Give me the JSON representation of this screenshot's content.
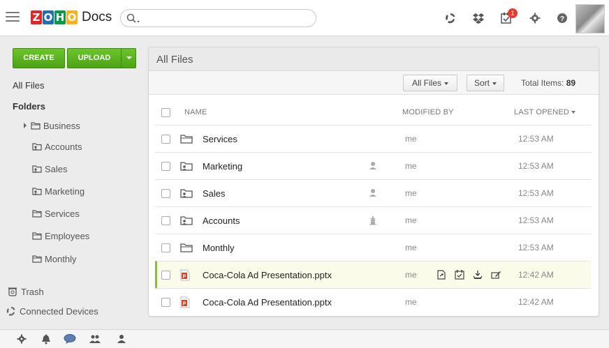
{
  "header": {
    "logo_letters": [
      "Z",
      "O",
      "H",
      "O"
    ],
    "logo_colors": [
      "#e42527",
      "#226db4",
      "#089949",
      "#f9b21d"
    ],
    "app_name": "Docs",
    "search_placeholder": "",
    "notification_count": "1",
    "icons": [
      "menu-icon",
      "search-icon",
      "sync-icon",
      "dropbox-icon",
      "tasks-icon",
      "gear-icon",
      "help-icon",
      "avatar"
    ]
  },
  "sidebar": {
    "create_label": "CREATE",
    "upload_label": "UPLOAD",
    "all_files": "All Files",
    "folders_heading": "Folders",
    "folders": [
      {
        "label": "Business",
        "icon": "folder-icon",
        "expandable": true
      },
      {
        "label": "Accounts",
        "icon": "shared-folder-icon"
      },
      {
        "label": "Sales",
        "icon": "shared-folder-icon"
      },
      {
        "label": "Marketing",
        "icon": "shared-folder-icon"
      },
      {
        "label": "Services",
        "icon": "folder-icon"
      },
      {
        "label": "Employees",
        "icon": "folder-icon"
      },
      {
        "label": "Monthly",
        "icon": "folder-icon"
      }
    ],
    "trash": "Trash",
    "connected_devices": "Connected Devices"
  },
  "main": {
    "title": "All Files",
    "filter_label": "All Files",
    "sort_label": "Sort",
    "total_label": "Total Items:",
    "total_count": "89",
    "columns": {
      "name": "NAME",
      "modified_by": "MODIFIED BY",
      "last_opened": "LAST OPENED"
    },
    "rows": [
      {
        "name": "Services",
        "icon": "folder-icon",
        "share": "",
        "modified_by": "me",
        "time": "12:53 AM"
      },
      {
        "name": "Marketing",
        "icon": "shared-folder-icon",
        "share": "user-icon",
        "modified_by": "me",
        "time": "12:53 AM"
      },
      {
        "name": "Sales",
        "icon": "shared-folder-icon",
        "share": "user-icon",
        "modified_by": "me",
        "time": "12:53 AM"
      },
      {
        "name": "Accounts",
        "icon": "shared-folder-icon",
        "share": "building-icon",
        "modified_by": "me",
        "time": "12:53 AM"
      },
      {
        "name": "Monthly",
        "icon": "folder-icon",
        "share": "",
        "modified_by": "me",
        "time": "12:53 AM"
      },
      {
        "name": "Coca-Cola Ad Presentation.pptx",
        "icon": "pptx-icon",
        "share": "",
        "modified_by": "me",
        "time": "12:42 AM",
        "selected": true
      },
      {
        "name": "Coca-Cola Ad Presentation.pptx",
        "icon": "pptx-icon",
        "share": "",
        "modified_by": "me",
        "time": "12:42 AM"
      }
    ]
  },
  "footer": {
    "icons": [
      "settings-icon",
      "bell-icon",
      "chat-icon",
      "group-icon",
      "user-icon"
    ]
  }
}
